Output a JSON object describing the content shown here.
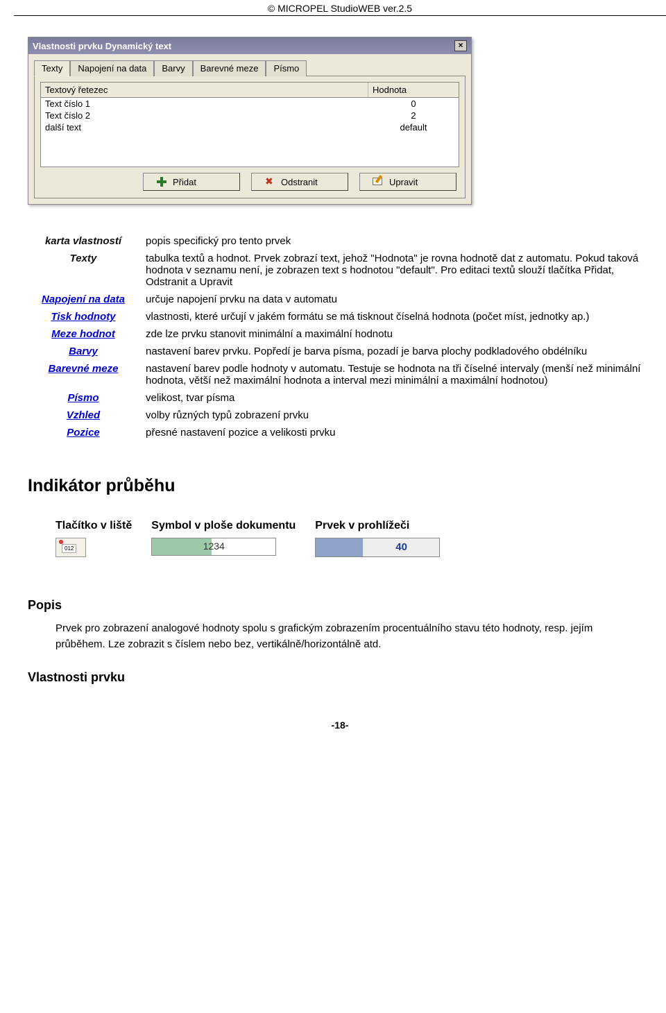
{
  "copyright": "© MICROPEL StudioWEB  ver.2.5",
  "dialog": {
    "title": "Vlastnosti prvku Dynamický text",
    "tabs": [
      "Texty",
      "Napojení na data",
      "Barvy",
      "Barevné meze",
      "Písmo"
    ],
    "cols": [
      "Textový řetezec",
      "Hodnota"
    ],
    "rows": [
      {
        "text": "Text číslo 1",
        "value": "0"
      },
      {
        "text": "Text číslo 2",
        "value": "2"
      },
      {
        "text": "další text",
        "value": "default"
      }
    ],
    "buttons": {
      "add": "Přidat",
      "remove": "Odstranit",
      "edit": "Upravit"
    }
  },
  "props": {
    "header_left": "karta vlastností",
    "header_right": "popis specifický pro tento prvek",
    "rows": [
      {
        "label": "Texty",
        "link": false,
        "desc": "tabulka textů a hodnot. Prvek zobrazí text, jehož \"Hodnota\" je rovna hodnotě dat z automatu. Pokud taková hodnota v seznamu není, je zobrazen text s hodnotou \"default\". Pro editaci textů slouží tlačítka Přidat, Odstranit a Upravit"
      },
      {
        "label": "Napojení na data",
        "link": true,
        "desc": "určuje napojení prvku na data v automatu"
      },
      {
        "label": "Tisk hodnoty",
        "link": true,
        "desc": "vlastnosti, které určují v jakém formátu se má tisknout číselná hodnota (počet míst, jednotky ap.)"
      },
      {
        "label": "Meze hodnot",
        "link": true,
        "desc": "zde lze prvku stanovit minimální a maximální hodnotu"
      },
      {
        "label": "Barvy",
        "link": true,
        "desc": "nastavení barev prvku. Popředí je barva písma, pozadí je barva plochy podkladového obdélníku"
      },
      {
        "label": "Barevné meze",
        "link": true,
        "desc": "nastavení barev podle hodnoty v automatu. Testuje se hodnota na tři číselné intervaly (menší než minimální hodnota, větší než maximální hodnota a interval mezi minimální a maximální hodnotou)"
      },
      {
        "label": "Písmo",
        "link": true,
        "desc": "velikost, tvar písma"
      },
      {
        "label": "Vzhled",
        "link": true,
        "desc": "volby různých typů zobrazení prvku"
      },
      {
        "label": "Pozice",
        "link": true,
        "desc": "přesné nastavení pozice a velikosti prvku"
      }
    ]
  },
  "section": {
    "title": "Indikátor průběhu",
    "trio": [
      "Tlačítko v liště",
      "Symbol v ploše dokumentu",
      "Prvek v prohlížeči"
    ],
    "sym_value": "1234",
    "view_value": "40"
  },
  "popis": {
    "h": "Popis",
    "text": "Prvek pro zobrazení analogové hodnoty spolu s grafickým zobrazením procentuálního stavu této hodnoty, resp. jejím průběhem. Lze zobrazit s číslem nebo bez, vertikálně/horizontálně atd.",
    "h2": "Vlastnosti prvku"
  },
  "pagenum": "-18-"
}
